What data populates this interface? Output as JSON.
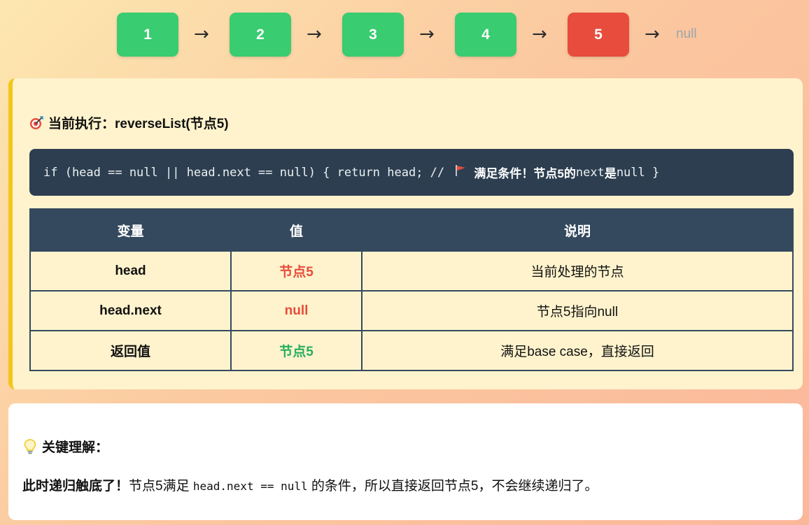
{
  "linked_list": {
    "nodes": [
      {
        "label": "1",
        "color": "#39cc70"
      },
      {
        "label": "2",
        "color": "#39cc70"
      },
      {
        "label": "3",
        "color": "#39cc70"
      },
      {
        "label": "4",
        "color": "#39cc70"
      },
      {
        "label": "5",
        "color": "#e74c3c"
      }
    ],
    "arrow": "→",
    "tail": "null"
  },
  "execution": {
    "icon": "target-icon",
    "title": "当前执行：reverseList(节点5)",
    "code": "if (head == null || head.next == null) { return head; // ",
    "flag_icon": "red-flag-icon",
    "comment": "满足条件！节点5的",
    "comment_code_a": "next",
    "comment_mid": "是",
    "comment_code_b": "null",
    "code_end": " }"
  },
  "table": {
    "headers": [
      "变量",
      "值",
      "说明"
    ],
    "rows": [
      {
        "name": "head",
        "value": "节点5",
        "desc": "当前处理的节点"
      },
      {
        "name": "head.next",
        "value": "null",
        "desc": "节点5指向null"
      },
      {
        "name": "返回值",
        "value": "节点5",
        "desc": "满足base case，直接返回"
      }
    ]
  },
  "tip": {
    "icon": "lightbulb-icon",
    "title": "关键理解：",
    "bold": "此时递归触底了！",
    "text_a": "节点5满足 ",
    "code": "head.next == null",
    "text_b": " 的条件，所以直接返回节点5，不会继续递归了。"
  },
  "colors": {
    "green": "#39cc70",
    "red": "#e74c3c",
    "dark": "#34495e",
    "code_bg": "#2c3e50",
    "card_yellow": "#fff3cd",
    "accent": "#f5c518"
  }
}
